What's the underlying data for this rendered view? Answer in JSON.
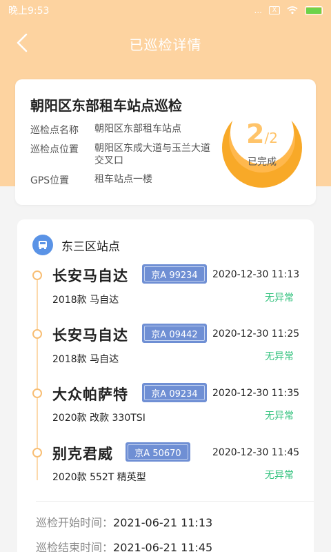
{
  "status_bar": {
    "time": "晚上9:53",
    "signal": "...",
    "sim_badge": "X"
  },
  "nav": {
    "title": "已巡检详情"
  },
  "summary": {
    "title": "朝阳区东部租车站点巡检",
    "rows": [
      {
        "label": "巡检点名称",
        "value": "朝阳区东部租车站点"
      },
      {
        "label": "巡检点位置",
        "value": "朝阳区东成大道与玉兰大道交叉口"
      },
      {
        "label": "GPS位置",
        "value": "租车站点一楼"
      }
    ],
    "progress": {
      "done": "2",
      "total": "/2",
      "label": "已完成",
      "fraction": 1.0
    }
  },
  "station": {
    "name": "东三区站点",
    "items": [
      {
        "car": "长安马自达",
        "plate": "京A 99234",
        "time": "2020-12-30 11:13",
        "model": "2018款 马自达",
        "status": "无异常"
      },
      {
        "car": "长安马自达",
        "plate": "京A 09442",
        "time": "2020-12-30 11:25",
        "model": "2018款 马自达",
        "status": "无异常"
      },
      {
        "car": "大众帕萨特",
        "plate": "京A 09234",
        "time": "2020-12-30 11:35",
        "model": "2020款 改款 330TSI",
        "status": "无异常"
      },
      {
        "car": "别克君威",
        "plate": "京A 50670",
        "time": "2020-12-30 11:45",
        "model": "2020款 552T 精英型",
        "status": "无异常"
      }
    ]
  },
  "meta": {
    "start_label": "巡检开始时间：",
    "start_value": "2021-06-21 11:13",
    "end_label": "巡检结束时间：",
    "end_value": "2021-06-21 11:45"
  },
  "colors": {
    "header": "#fdd3a0",
    "accent": "#f8a928",
    "plate": "#6f8fd4",
    "ok": "#33c27e",
    "station_icon": "#5a93e6"
  },
  "icons": {
    "back": "chevron-left-icon",
    "station": "bus-icon",
    "wifi": "wifi-icon",
    "battery": "battery-icon"
  }
}
